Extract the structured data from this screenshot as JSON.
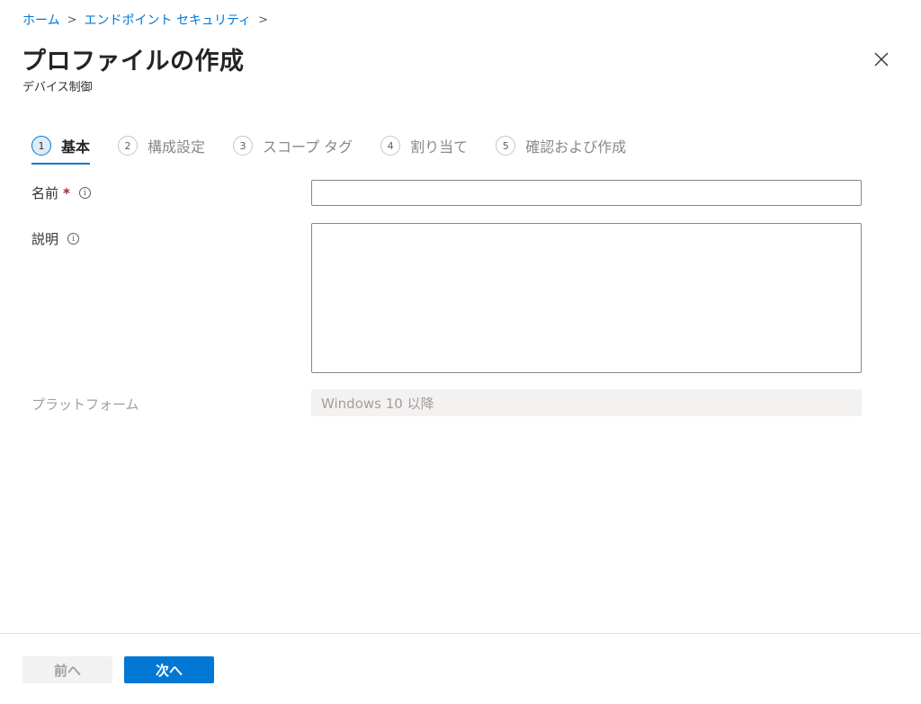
{
  "breadcrumb": {
    "items": [
      "ホーム",
      "エンドポイント セキュリティ"
    ],
    "separator": ">"
  },
  "header": {
    "title": "プロファイルの作成",
    "subtitle": "デバイス制御",
    "close_icon": "close-icon"
  },
  "steps": [
    {
      "number": "1",
      "label": "基本",
      "active": true
    },
    {
      "number": "2",
      "label": "構成設定",
      "active": false
    },
    {
      "number": "3",
      "label": "スコープ タグ",
      "active": false
    },
    {
      "number": "4",
      "label": "割り当て",
      "active": false
    },
    {
      "number": "5",
      "label": "確認および作成",
      "active": false
    }
  ],
  "form": {
    "name_label": "名前",
    "required_marker": "*",
    "name_value": "",
    "description_label": "説明",
    "description_value": "",
    "info_glyph": "i",
    "platform_label": "プラットフォーム",
    "platform_value": "Windows 10 以降"
  },
  "footer": {
    "prev_label": "前へ",
    "next_label": "次へ"
  },
  "colors": {
    "accent": "#0078d4",
    "required": "#a4262c",
    "disabled_bg": "#f3f2f1"
  }
}
